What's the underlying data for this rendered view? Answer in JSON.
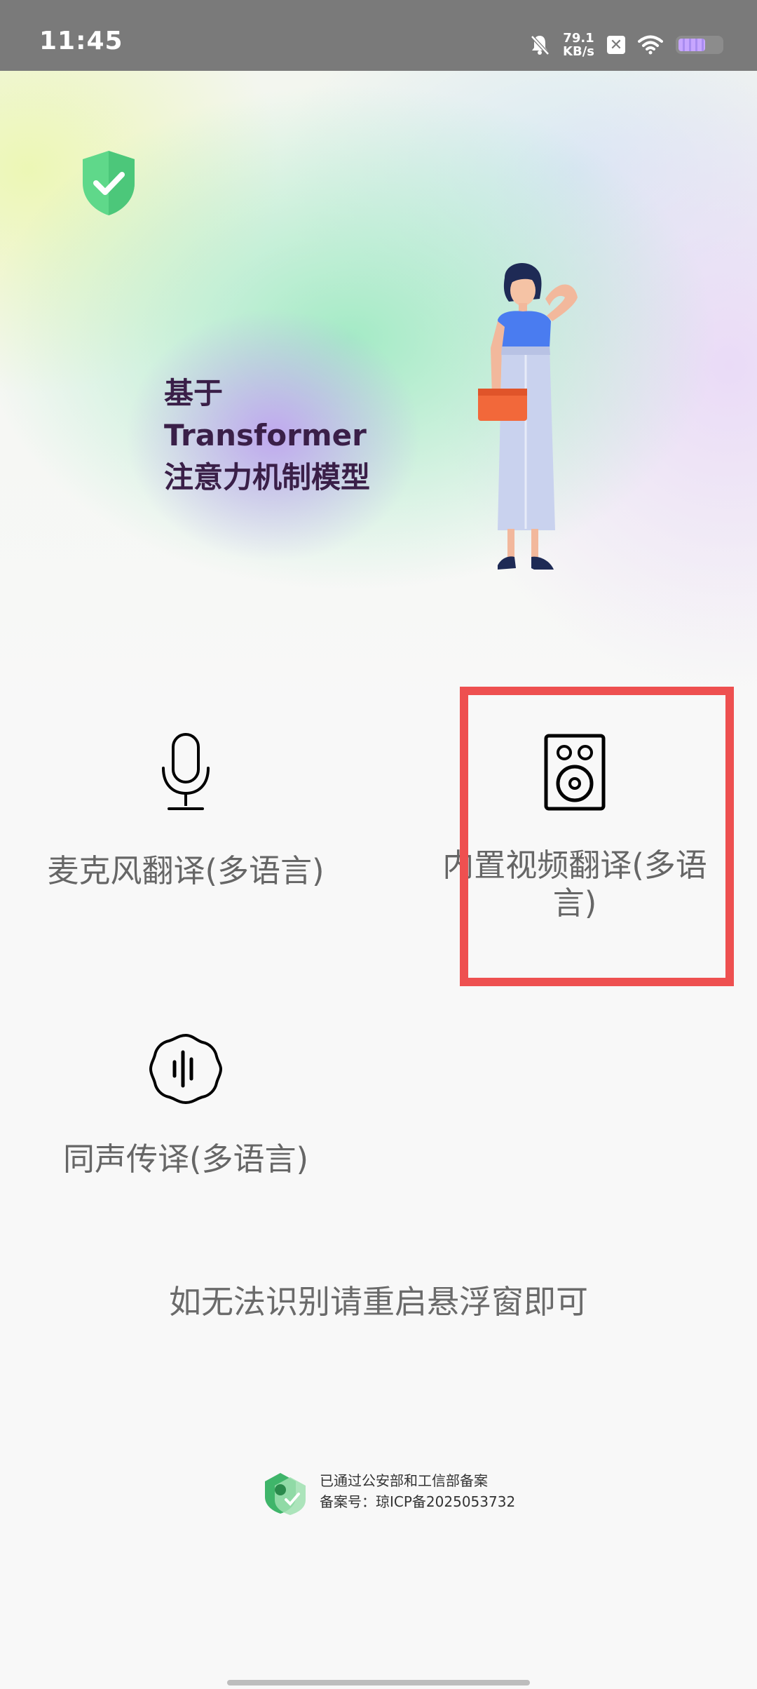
{
  "status_bar": {
    "time": "11:45",
    "net_speed_value": "79.1",
    "net_speed_unit": "KB/s",
    "icons": [
      "bell-off-icon",
      "x-box-icon",
      "wifi-icon",
      "battery-icon"
    ]
  },
  "hero": {
    "title_lines": [
      "基于",
      "Transformer",
      "注意力机制模型"
    ]
  },
  "features": [
    {
      "label": "麦克风翻译(多语言)",
      "icon": "microphone-icon"
    },
    {
      "label": "内置视频翻译(多语言)",
      "icon": "speaker-icon"
    },
    {
      "label": "同声传译(多语言)",
      "icon": "sound-wave-badge-icon"
    }
  ],
  "hint": "如无法识别请重启悬浮窗即可",
  "filing": {
    "line1": "已通过公安部和工信部备案",
    "line2": "备案号：琼ICP备2025053732"
  },
  "colors": {
    "status_bar_bg": "#7a7a7a",
    "title_color": "#3a1f48",
    "highlight_border": "#ee5050",
    "shield_green": "#5fd88a"
  }
}
